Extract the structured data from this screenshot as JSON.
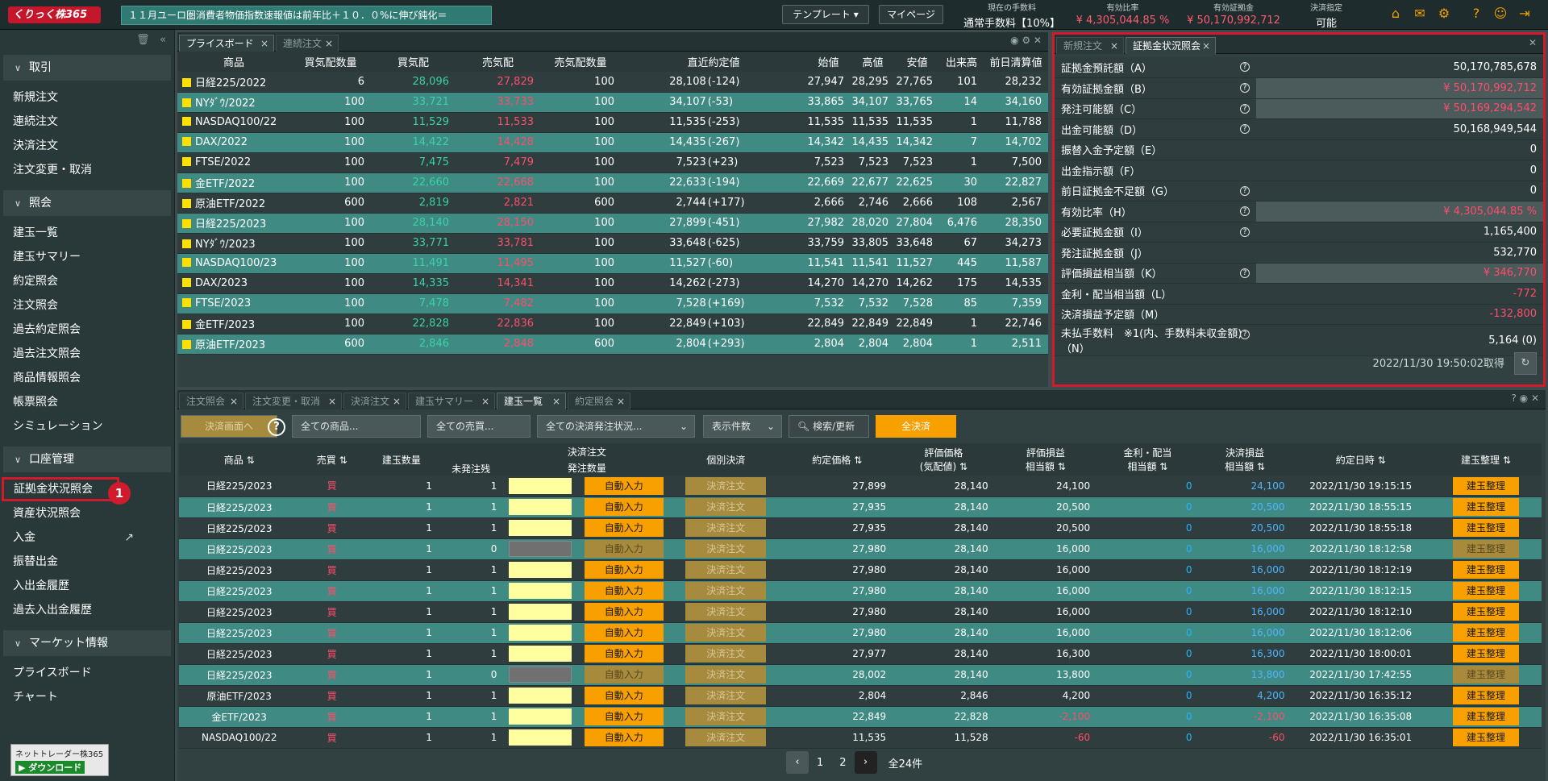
{
  "header": {
    "logo": "くりっく株365",
    "ticker": "１１月ユーロ圏消費者物価指数速報値は前年比＋１０．０%に伸び鈍化＝",
    "template_btn": "テンプレート",
    "mypage_btn": "マイページ",
    "fee_label": "現在の手数料",
    "fee_value": "通常手数料【10%】",
    "ratio_label": "有効比率",
    "ratio_value": "¥ 4,305,044.85 %",
    "margin_label": "有効証拠金",
    "margin_value": "¥ 50,170,992,712",
    "settle_label": "決済指定",
    "settle_value": "可能",
    "icons": [
      "home-icon",
      "mail-icon",
      "gear-icon",
      "help-icon",
      "user-icon",
      "logout-icon"
    ]
  },
  "sidebar": {
    "sections": [
      {
        "title": "取引",
        "items": [
          "新規注文",
          "連続注文",
          "決済注文",
          "注文変更・取消"
        ]
      },
      {
        "title": "照会",
        "items": [
          "建玉一覧",
          "建玉サマリー",
          "約定照会",
          "注文照会",
          "過去約定照会",
          "過去注文照会",
          "商品情報照会",
          "帳票照会",
          "シミュレーション"
        ]
      },
      {
        "title": "口座管理",
        "items": [
          "証拠金状況照会",
          "資産状況照会",
          "入金",
          "振替出金",
          "入出金履歴",
          "過去入出金履歴"
        ]
      },
      {
        "title": "マーケット情報",
        "items": [
          "プライスボード",
          "チャート"
        ]
      }
    ],
    "badge": "1",
    "download_top": "ネットトレーダー株365",
    "download_btn": "ダウンロード"
  },
  "priceboard": {
    "tabs": [
      "プライスボード",
      "連続注文"
    ],
    "headers": [
      "商品",
      "買気配数量",
      "買気配",
      "売気配",
      "売気配数量",
      "直近約定値",
      "始値",
      "高値",
      "安値",
      "出来高",
      "前日清算値"
    ],
    "rows": [
      [
        "日経225/2022",
        "6",
        "28,096",
        "27,829",
        "100",
        "28,108",
        "(-124)",
        "27,947",
        "28,295",
        "27,765",
        "101",
        "28,232"
      ],
      [
        "NYﾀﾞｳ/2022",
        "100",
        "33,721",
        "33,733",
        "100",
        "34,107",
        "(-53)",
        "33,865",
        "34,107",
        "33,765",
        "14",
        "34,160"
      ],
      [
        "NASDAQ100/22",
        "100",
        "11,529",
        "11,533",
        "100",
        "11,535",
        "(-253)",
        "11,535",
        "11,535",
        "11,535",
        "1",
        "11,788"
      ],
      [
        "DAX/2022",
        "100",
        "14,422",
        "14,428",
        "100",
        "14,435",
        "(-267)",
        "14,342",
        "14,435",
        "14,342",
        "7",
        "14,702"
      ],
      [
        "FTSE/2022",
        "100",
        "7,475",
        "7,479",
        "100",
        "7,523",
        "(+23)",
        "7,523",
        "7,523",
        "7,523",
        "1",
        "7,500"
      ],
      [
        "金ETF/2022",
        "100",
        "22,660",
        "22,668",
        "100",
        "22,633",
        "(-194)",
        "22,669",
        "22,677",
        "22,625",
        "30",
        "22,827"
      ],
      [
        "原油ETF/2022",
        "600",
        "2,819",
        "2,821",
        "600",
        "2,744",
        "(+177)",
        "2,666",
        "2,746",
        "2,666",
        "108",
        "2,567"
      ],
      [
        "日経225/2023",
        "100",
        "28,140",
        "28,150",
        "100",
        "27,899",
        "(-451)",
        "27,982",
        "28,020",
        "27,804",
        "6,476",
        "28,350"
      ],
      [
        "NYﾀﾞｳ/2023",
        "100",
        "33,771",
        "33,781",
        "100",
        "33,648",
        "(-625)",
        "33,759",
        "33,805",
        "33,648",
        "67",
        "34,273"
      ],
      [
        "NASDAQ100/23",
        "100",
        "11,491",
        "11,495",
        "100",
        "11,527",
        "(-60)",
        "11,541",
        "11,541",
        "11,527",
        "445",
        "11,587"
      ],
      [
        "DAX/2023",
        "100",
        "14,335",
        "14,341",
        "100",
        "14,262",
        "(-273)",
        "14,270",
        "14,270",
        "14,262",
        "175",
        "14,535"
      ],
      [
        "FTSE/2023",
        "100",
        "7,478",
        "7,482",
        "100",
        "7,528",
        "(+169)",
        "7,532",
        "7,532",
        "7,528",
        "85",
        "7,359"
      ],
      [
        "金ETF/2023",
        "100",
        "22,828",
        "22,836",
        "100",
        "22,849",
        "(+103)",
        "22,849",
        "22,849",
        "22,849",
        "1",
        "22,746"
      ],
      [
        "原油ETF/2023",
        "600",
        "2,846",
        "2,848",
        "600",
        "2,804",
        "(+293)",
        "2,804",
        "2,804",
        "2,804",
        "1",
        "2,511"
      ]
    ]
  },
  "margin": {
    "tabs": [
      "新規注文",
      "証拠金状況照会"
    ],
    "rows": [
      {
        "label": "証拠金預託額（A）",
        "value": "50,170,785,678",
        "q": true,
        "hl": false
      },
      {
        "label": "有効証拠金額（B）",
        "value": "¥ 50,170,992,712",
        "q": true,
        "hl": true
      },
      {
        "label": "発注可能額（C）",
        "value": "¥ 50,169,294,542",
        "q": true,
        "hl": true
      },
      {
        "label": "出金可能額（D）",
        "value": "50,168,949,544",
        "q": true,
        "hl": false
      },
      {
        "label": "振替入金予定額（E）",
        "value": "0",
        "q": false,
        "hl": false
      },
      {
        "label": "出金指示額（F）",
        "value": "0",
        "q": false,
        "hl": false
      },
      {
        "label": "前日証拠金不足額（G）",
        "value": "0",
        "q": true,
        "hl": false
      },
      {
        "label": "有効比率（H）",
        "value": "¥ 4,305,044.85 %",
        "q": true,
        "hl": true
      },
      {
        "label": "必要証拠金額（I）",
        "value": "1,165,400",
        "q": true,
        "hl": false
      },
      {
        "label": "発注証拠金額（J）",
        "value": "532,770",
        "q": false,
        "hl": false
      },
      {
        "label": "評価損益相当額（K）",
        "value": "¥ 346,770",
        "q": true,
        "hl": true
      },
      {
        "label": "金利・配当相当額（L）",
        "value": "-772",
        "q": false,
        "hl": false,
        "neg": true
      },
      {
        "label": "決済損益予定額（M）",
        "value": "-132,800",
        "q": false,
        "hl": false,
        "neg": true
      },
      {
        "label": "未払手数料　※1(内、手数料未収金額)（N）",
        "value": "5,164 (0)",
        "q": true,
        "hl": false
      }
    ],
    "timestamp": "2022/11/30 19:50:02取得"
  },
  "positions": {
    "tabs": [
      "注文照会",
      "注文変更・取消",
      "決済注文",
      "建玉サマリー",
      "建玉一覧",
      "約定照会"
    ],
    "filters": {
      "close_screen": "決済画面へ",
      "product": "全ての商品...",
      "side": "全ての売買...",
      "order_status": "全ての決済発注状況...",
      "count": "表示件数",
      "search": "検索/更新",
      "all_close": "全決済"
    },
    "headers": {
      "product": "商品",
      "side": "売買",
      "qty": "建玉数量",
      "unfilled": "未発注残",
      "close_order": "決済注文",
      "order_qty": "発注数量",
      "indiv": "個別決済",
      "price": "約定価格",
      "eval_price": "評価価格\n(気配値)",
      "eval_pl": "評価損益\n相当額",
      "interest": "金利・配当\n相当額",
      "settle_pl": "決済損益\n相当額",
      "date": "約定日時",
      "manage": "建玉整理"
    },
    "auto_label": "自動入力",
    "close_label": "決済注文",
    "manage_label": "建玉整理",
    "rows": [
      [
        "日経225/2023",
        "買",
        "1",
        "1",
        "27,899",
        "28,140",
        "24,100",
        "0",
        "24,100",
        "2022/11/30 19:15:15",
        true
      ],
      [
        "日経225/2023",
        "買",
        "1",
        "1",
        "27,935",
        "28,140",
        "20,500",
        "0",
        "20,500",
        "2022/11/30 18:55:15",
        true
      ],
      [
        "日経225/2023",
        "買",
        "1",
        "1",
        "27,935",
        "28,140",
        "20,500",
        "0",
        "20,500",
        "2022/11/30 18:55:18",
        true
      ],
      [
        "日経225/2023",
        "買",
        "1",
        "0",
        "27,980",
        "28,140",
        "16,000",
        "0",
        "16,000",
        "2022/11/30 18:12:58",
        false
      ],
      [
        "日経225/2023",
        "買",
        "1",
        "1",
        "27,980",
        "28,140",
        "16,000",
        "0",
        "16,000",
        "2022/11/30 18:12:19",
        true
      ],
      [
        "日経225/2023",
        "買",
        "1",
        "1",
        "27,980",
        "28,140",
        "16,000",
        "0",
        "16,000",
        "2022/11/30 18:12:15",
        true
      ],
      [
        "日経225/2023",
        "買",
        "1",
        "1",
        "27,980",
        "28,140",
        "16,000",
        "0",
        "16,000",
        "2022/11/30 18:12:10",
        true
      ],
      [
        "日経225/2023",
        "買",
        "1",
        "1",
        "27,980",
        "28,140",
        "16,000",
        "0",
        "16,000",
        "2022/11/30 18:12:06",
        true
      ],
      [
        "日経225/2023",
        "買",
        "1",
        "1",
        "27,977",
        "28,140",
        "16,300",
        "0",
        "16,300",
        "2022/11/30 18:00:01",
        true
      ],
      [
        "日経225/2023",
        "買",
        "1",
        "0",
        "28,002",
        "28,140",
        "13,800",
        "0",
        "13,800",
        "2022/11/30 17:42:55",
        false
      ],
      [
        "原油ETF/2023",
        "買",
        "1",
        "1",
        "2,804",
        "2,846",
        "4,200",
        "0",
        "4,200",
        "2022/11/30 16:35:12",
        true
      ],
      [
        "金ETF/2023",
        "買",
        "1",
        "1",
        "22,849",
        "22,828",
        "-2,100",
        "0",
        "-2,100",
        "2022/11/30 16:35:08",
        true
      ],
      [
        "NASDAQ100/22",
        "買",
        "1",
        "1",
        "11,535",
        "11,528",
        "-60",
        "0",
        "-60",
        "2022/11/30 16:35:01",
        true
      ]
    ],
    "pager": {
      "page1": "1",
      "page2": "2",
      "total": "全24件"
    }
  }
}
